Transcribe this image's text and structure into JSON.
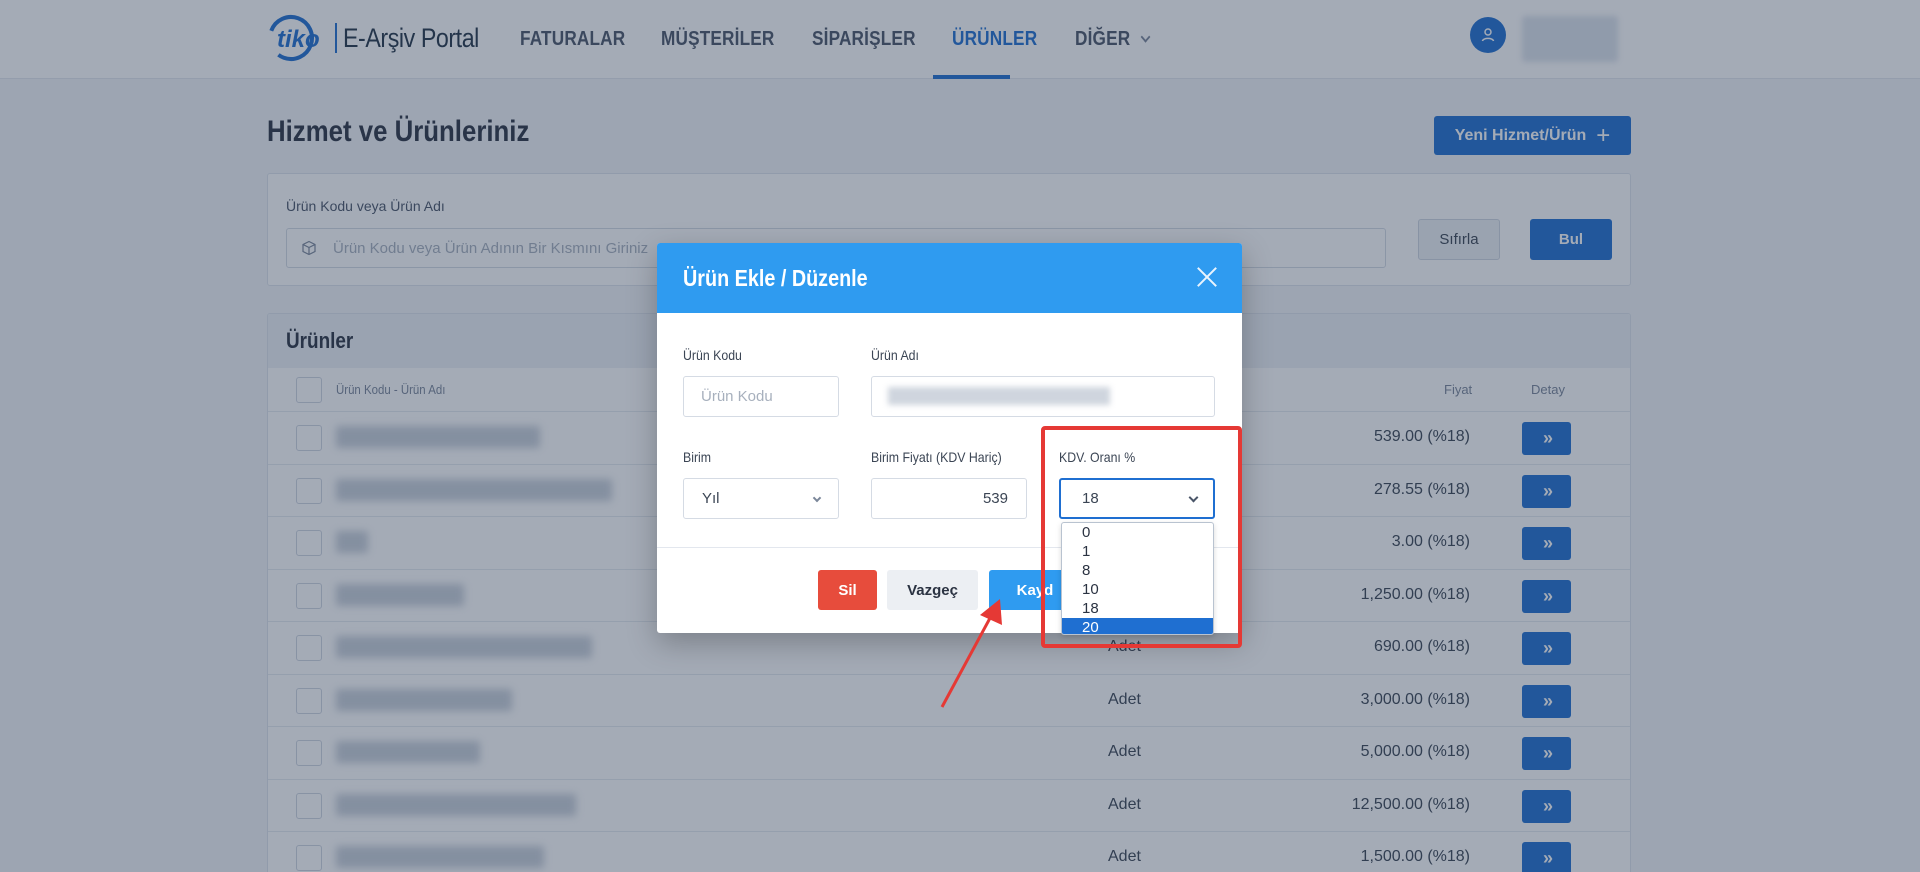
{
  "header": {
    "logo_mark": "tiko",
    "logo_text": "E-Arşiv Portal",
    "nav": [
      {
        "label": "FATURALAR",
        "active": false
      },
      {
        "label": "MÜŞTERİLER",
        "active": false
      },
      {
        "label": "SİPARİŞLER",
        "active": false
      },
      {
        "label": "ÜRÜNLER",
        "active": true
      },
      {
        "label": "DİĞER",
        "active": false
      }
    ],
    "user_icon": "user-icon"
  },
  "page": {
    "title": "Hizmet ve Ürünleriniz",
    "new_button": "Yeni Hizmet/Ürün",
    "new_button_icon": "plus-icon"
  },
  "search": {
    "label": "Ürün Kodu veya Ürün Adı",
    "placeholder": "Ürün Kodu veya Ürün Adının Bir Kısmını Giriniz",
    "icon": "box-icon",
    "reset_label": "Sıfırla",
    "find_label": "Bul"
  },
  "products": {
    "title": "Ürünler",
    "columns": {
      "name": "Ürün Kodu - Ürün Adı",
      "price": "Fiyat",
      "detail": "Detay"
    },
    "rows": [
      {
        "unit": "",
        "price": "539.00 (%18)"
      },
      {
        "unit": "",
        "price": "278.55 (%18)"
      },
      {
        "unit": "",
        "price": "3.00 (%18)"
      },
      {
        "unit": "",
        "price": "1,250.00 (%18)"
      },
      {
        "unit": "Adet",
        "price": "690.00 (%18)"
      },
      {
        "unit": "Adet",
        "price": "3,000.00 (%18)"
      },
      {
        "unit": "Adet",
        "price": "5,000.00 (%18)"
      },
      {
        "unit": "Adet",
        "price": "12,500.00 (%18)"
      },
      {
        "unit": "Adet",
        "price": "1,500.00 (%18)"
      }
    ],
    "detail_icon": "double-chevron-right-icon"
  },
  "modal": {
    "title": "Ürün Ekle / Düzenle",
    "product_code_label": "Ürün Kodu",
    "product_code_placeholder": "Ürün Kodu",
    "product_name_label": "Ürün Adı",
    "unit_label": "Birim",
    "unit_value": "Yıl",
    "unit_price_label": "Birim Fiyatı (KDV Hariç)",
    "unit_price_value": "539",
    "vat_label": "KDV. Oranı %",
    "vat_value": "18",
    "vat_options": [
      "0",
      "1",
      "8",
      "10",
      "18",
      "20"
    ],
    "vat_highlighted": "20",
    "delete_label": "Sil",
    "cancel_label": "Vazgeç",
    "save_label": "Kaydet",
    "save_visible_text": "Kayd"
  },
  "colors": {
    "brand": "#1f6fd1",
    "modal_header": "#2f9bf0",
    "danger": "#e74c3c",
    "annotation": "#e53935"
  }
}
